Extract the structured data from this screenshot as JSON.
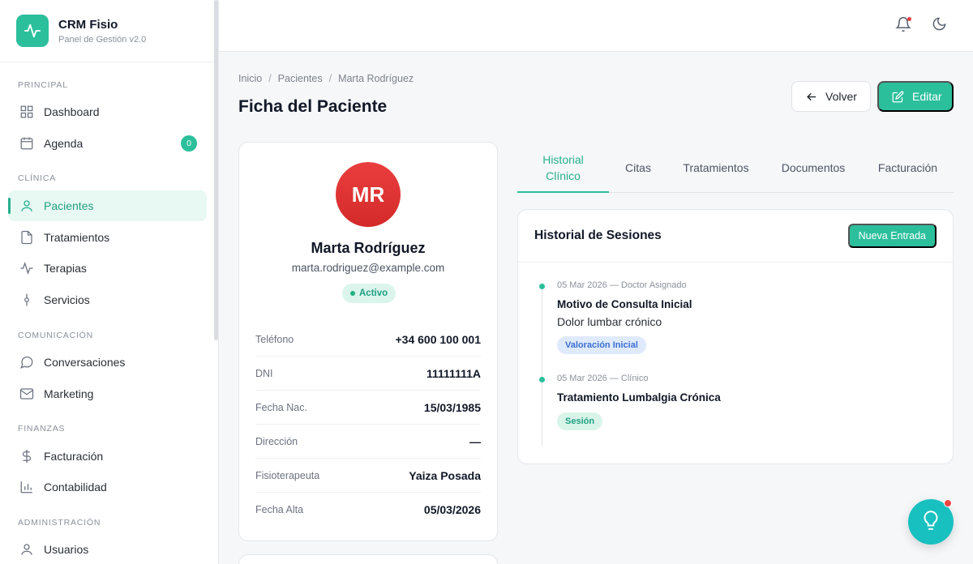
{
  "brand": {
    "title": "CRM Fisio",
    "subtitle": "Panel de Gestión v2.0"
  },
  "sidebar": {
    "sections": [
      "PRINCIPAL",
      "CLÍNICA",
      "COMUNICACIÓN",
      "FINANZAS",
      "ADMINISTRACIÓN"
    ],
    "items": [
      {
        "label": "Dashboard",
        "icon": "grid-icon"
      },
      {
        "label": "Agenda",
        "icon": "calendar-icon",
        "badge": "0"
      },
      {
        "label": "Pacientes",
        "icon": "user-icon",
        "active": true
      },
      {
        "label": "Tratamientos",
        "icon": "file-icon"
      },
      {
        "label": "Terapias",
        "icon": "activity-icon"
      },
      {
        "label": "Servicios",
        "icon": "git-commit-icon"
      },
      {
        "label": "Conversaciones",
        "icon": "message-icon"
      },
      {
        "label": "Marketing",
        "icon": "mail-icon"
      },
      {
        "label": "Facturación",
        "icon": "dollar-icon"
      },
      {
        "label": "Contabilidad",
        "icon": "bar-chart-icon"
      },
      {
        "label": "Usuarios",
        "icon": "user-icon"
      }
    ]
  },
  "breadcrumb": [
    "Inicio",
    "Pacientes",
    "Marta Rodríguez"
  ],
  "page": {
    "title": "Ficha del Paciente",
    "back_label": "Volver",
    "edit_label": "Editar"
  },
  "patient": {
    "initials": "MR",
    "name": "Marta Rodríguez",
    "email": "marta.rodriguez@example.com",
    "status": "Activo",
    "fields": [
      {
        "label": "Teléfono",
        "value": "+34 600 100 001"
      },
      {
        "label": "DNI",
        "value": "11111111A"
      },
      {
        "label": "Fecha Nac.",
        "value": "15/03/1985"
      },
      {
        "label": "Dirección",
        "value": "—"
      },
      {
        "label": "Fisioterapeuta",
        "value": "Yaiza Posada"
      },
      {
        "label": "Fecha Alta",
        "value": "05/03/2026"
      }
    ]
  },
  "tabs": [
    "Historial Clínico",
    "Citas",
    "Tratamientos",
    "Documentos",
    "Facturación"
  ],
  "sessions": {
    "title": "Historial de Sesiones",
    "new_label": "Nueva Entrada",
    "entries": [
      {
        "meta": "05 Mar 2026 — Doctor Asignado",
        "title": "Motivo de Consulta Inicial",
        "desc": "Dolor lumbar crónico",
        "tag": "Valoración Inicial"
      },
      {
        "meta": "05 Mar 2026 — Clínico",
        "title": "Tratamiento Lumbalgia Crónica",
        "tag": "Sesión"
      }
    ]
  },
  "colors": {
    "accent": "#2cbf9c",
    "avatar": "#e03434",
    "fab": "#18c0c0"
  }
}
